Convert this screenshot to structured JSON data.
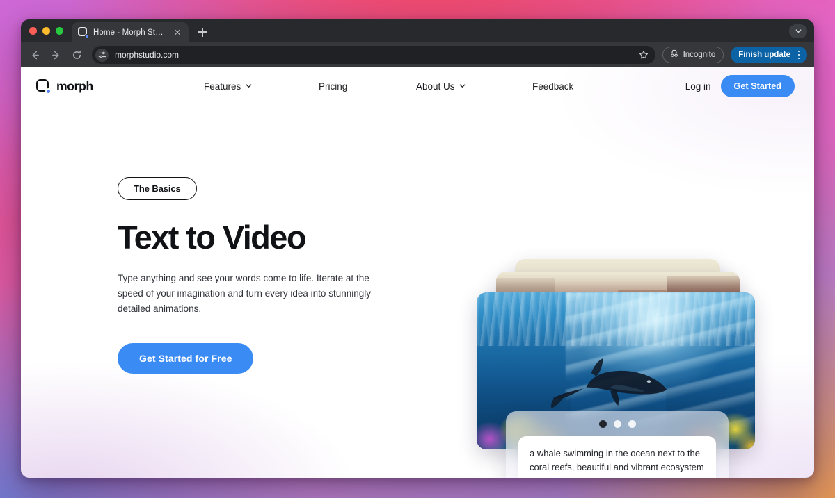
{
  "browser": {
    "traffic_lights": [
      "close",
      "minimize",
      "maximize"
    ],
    "tab": {
      "title": "Home - Morph Studio",
      "favicon": "morph-logo-icon",
      "close_icon": "close-icon"
    },
    "new_tab_icon": "plus-icon",
    "tabstrip_chevron_icon": "chevron-down-icon",
    "toolbar": {
      "back_icon": "back-arrow-icon",
      "forward_icon": "forward-arrow-icon",
      "reload_icon": "reload-icon",
      "site_info_icon": "tune-sliders-icon",
      "url": "morphstudio.com",
      "bookmark_icon": "star-icon",
      "incognito_label": "Incognito",
      "incognito_icon": "incognito-hat-icon",
      "update_label": "Finish update",
      "update_color": "#0b63a6",
      "menu_icon": "kebab-menu-icon"
    }
  },
  "site": {
    "brand": {
      "name": "morph",
      "logo_icon": "morph-logo-icon",
      "accent": "#4f7fff"
    },
    "nav_links": [
      {
        "label": "Features",
        "has_caret": true
      },
      {
        "label": "Pricing",
        "has_caret": false
      },
      {
        "label": "About Us",
        "has_caret": true
      },
      {
        "label": "Feedback",
        "has_caret": false
      }
    ],
    "login_label": "Log in",
    "get_started_label": "Get Started",
    "primary_color": "#3b8bf5"
  },
  "hero": {
    "badge": "The Basics",
    "title": "Text to Video",
    "description": "Type anything and see your words come to life. Iterate at the speed of your imagination and turn every idea into stunningly detailed animations.",
    "cta_label": "Get Started for Free"
  },
  "showcase": {
    "cards": [
      {
        "alt": "canyon landscape with mesas at sunrise"
      },
      {
        "alt": "red rock canyon cliffs"
      },
      {
        "alt": "a whale swimming underwater above a colorful coral reef"
      }
    ],
    "carousel": {
      "dots": 3,
      "active_index": 0
    },
    "prompt": "a whale swimming in the ocean next to the coral reefs, beautiful and vibrant ecosystem"
  }
}
